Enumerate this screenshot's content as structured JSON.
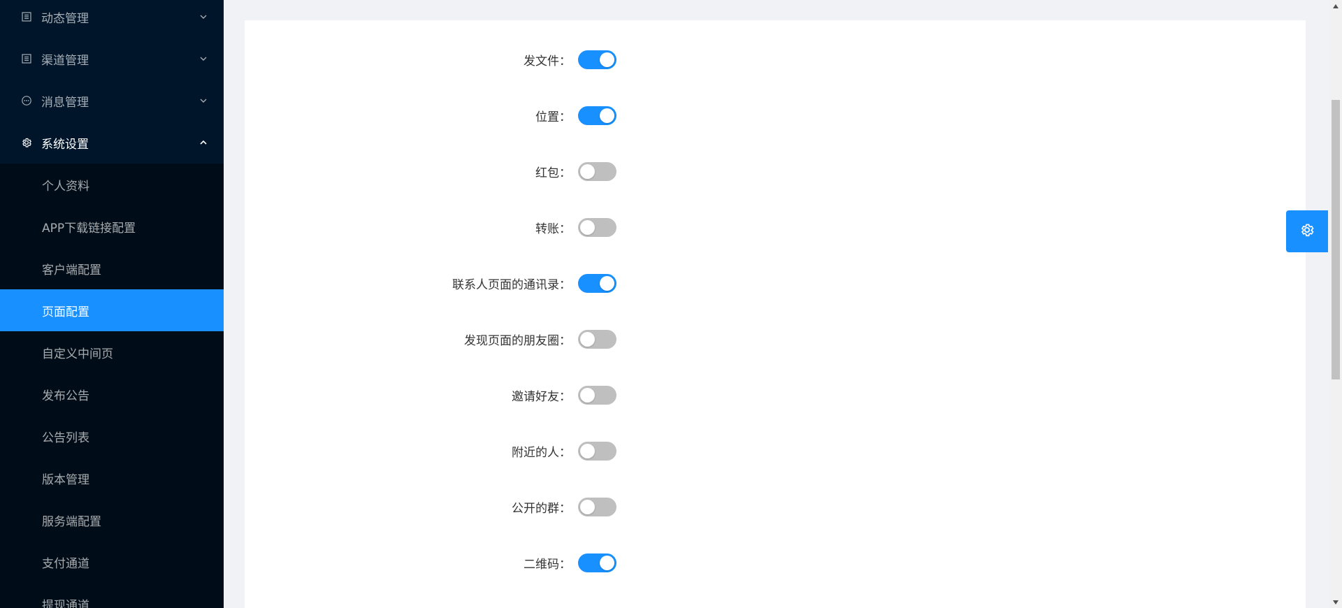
{
  "sidebar": {
    "top_items": [
      {
        "label": "动态管理",
        "icon": "list-icon",
        "expanded": false
      },
      {
        "label": "渠道管理",
        "icon": "list-icon",
        "expanded": false
      },
      {
        "label": "消息管理",
        "icon": "chat-icon",
        "expanded": false
      },
      {
        "label": "系统设置",
        "icon": "gear-icon",
        "expanded": true
      }
    ],
    "sub_items": [
      {
        "label": "个人资料"
      },
      {
        "label": "APP下载链接配置"
      },
      {
        "label": "客户端配置"
      },
      {
        "label": "页面配置",
        "active": true
      },
      {
        "label": "自定义中间页"
      },
      {
        "label": "发布公告"
      },
      {
        "label": "公告列表"
      },
      {
        "label": "版本管理"
      },
      {
        "label": "服务端配置"
      },
      {
        "label": "支付通道"
      },
      {
        "label": "提现通道"
      }
    ]
  },
  "form": {
    "colon": "：",
    "rows": [
      {
        "label": "发文件",
        "enabled": true
      },
      {
        "label": "位置",
        "enabled": true
      },
      {
        "label": "红包",
        "enabled": false
      },
      {
        "label": "转账",
        "enabled": false
      },
      {
        "label": "联系人页面的通讯录",
        "enabled": true
      },
      {
        "label": "发现页面的朋友圈",
        "enabled": false
      },
      {
        "label": "邀请好友",
        "enabled": false
      },
      {
        "label": "附近的人",
        "enabled": false
      },
      {
        "label": "公开的群",
        "enabled": false
      },
      {
        "label": "二维码",
        "enabled": true
      }
    ]
  },
  "colors": {
    "sidebar_bg": "#001529",
    "submenu_bg": "#000c17",
    "accent": "#1890ff",
    "switch_off": "#bfbfbf"
  }
}
